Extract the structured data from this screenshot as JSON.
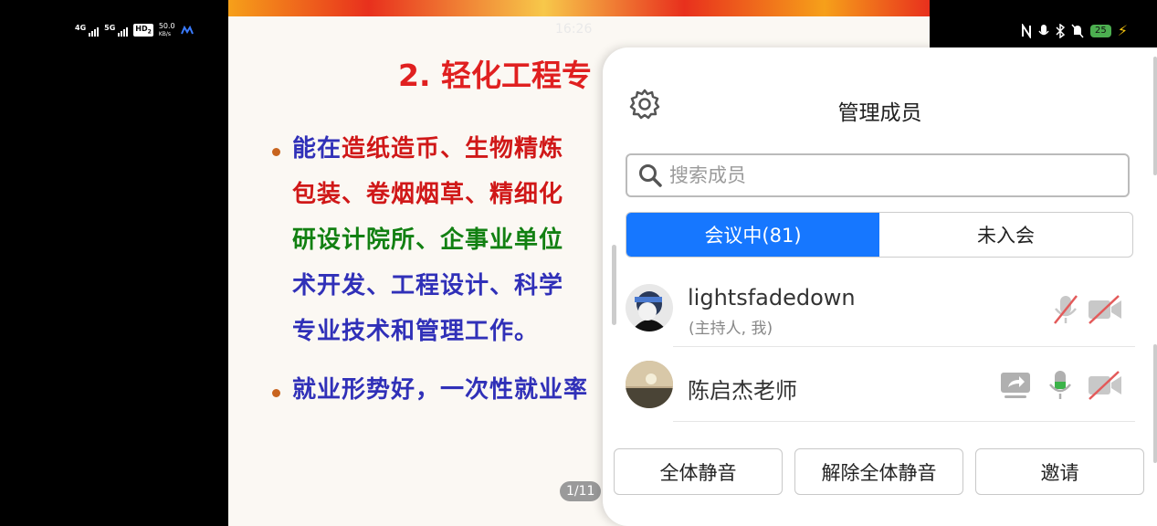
{
  "status_bar": {
    "net1": "4G",
    "net2": "5G",
    "hd": "HD",
    "hd_sub": "2",
    "speed_value": "50.0",
    "speed_unit": "KB/s",
    "battery": "25",
    "clock": "16:26"
  },
  "slide": {
    "title": "2. 轻化工程专",
    "para1": {
      "line1_a": "能在",
      "line1_b": "造纸造币、生物精炼",
      "line2": "包装、卷烟烟草、精细化",
      "line3": "研设计院所、企事业单位",
      "line4": "术开发、工程设计、科学",
      "line5": "专业技术和管理工作。"
    },
    "para2": "就业形势好，一次性就业率",
    "page_indicator": "1/11"
  },
  "panel": {
    "title": "管理成员",
    "search_placeholder": "搜索成员",
    "tabs": [
      {
        "label": "会议中(81)"
      },
      {
        "label": "未入会"
      }
    ],
    "members": [
      {
        "name": "lightsfadedown",
        "role": "(主持人, 我)"
      },
      {
        "name": "陈启杰老师"
      }
    ],
    "buttons": {
      "mute_all": "全体静音",
      "unmute_all": "解除全体静音",
      "invite": "邀请"
    }
  },
  "colors": {
    "accent": "#1677ff",
    "slide_title": "#e02020",
    "muted_red": "#e35a5a",
    "mic_active": "#3cb34a"
  }
}
